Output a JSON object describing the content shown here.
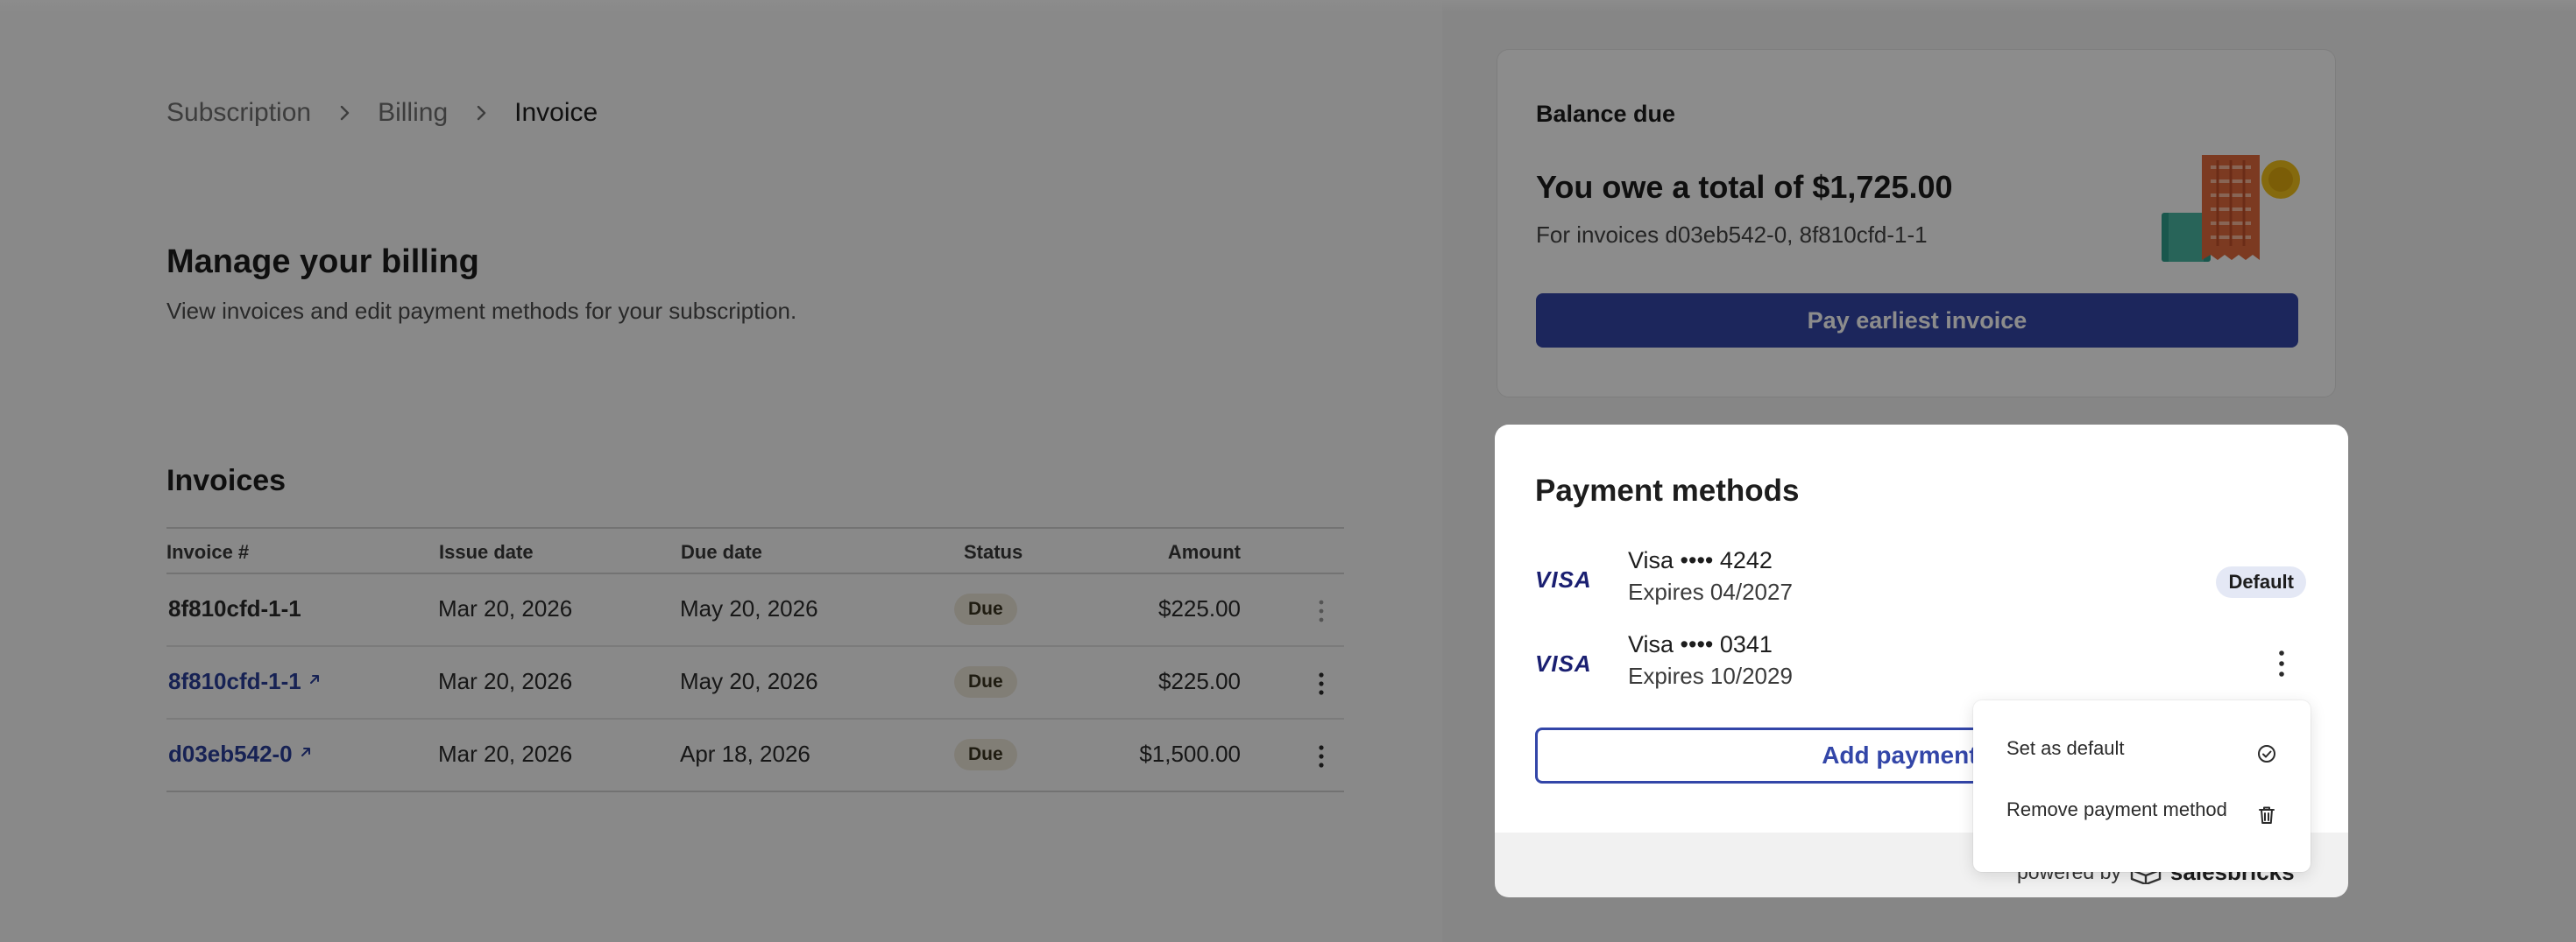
{
  "breadcrumb": {
    "items": [
      "Subscription",
      "Billing",
      "Invoice"
    ]
  },
  "page": {
    "title": "Manage your billing",
    "subtitle": "View invoices and edit payment methods for your subscription."
  },
  "invoices": {
    "title": "Invoices",
    "columns": [
      "Invoice #",
      "Issue date",
      "Due date",
      "Status",
      "Amount"
    ],
    "rows": [
      {
        "id": "8f810cfd-1-1",
        "link": false,
        "issue": "Mar 20, 2026",
        "due": "May 20, 2026",
        "status": "Due",
        "amount": "$225.00"
      },
      {
        "id": "8f810cfd-1-1",
        "link": true,
        "issue": "Mar 20, 2026",
        "due": "May 20, 2026",
        "status": "Due",
        "amount": "$225.00"
      },
      {
        "id": "d03eb542-0",
        "link": true,
        "issue": "Mar 20, 2026",
        "due": "Apr 18, 2026",
        "status": "Due",
        "amount": "$1,500.00"
      }
    ]
  },
  "balance": {
    "label": "Balance due",
    "total": "You owe a total of $1,725.00",
    "sub": "For invoices d03eb542-0, 8f810cfd-1-1",
    "pay_button": "Pay earliest invoice"
  },
  "payment_methods": {
    "title": "Payment methods",
    "cards": [
      {
        "brand": "VISA",
        "name": "Visa •••• 4242",
        "expires": "Expires 04/2027",
        "badge": "Default"
      },
      {
        "brand": "VISA",
        "name": "Visa •••• 0341",
        "expires": "Expires 10/2029",
        "badge": ""
      }
    ],
    "add_button": "Add payment me",
    "powered_by": "powered by",
    "brand": "salesbricks"
  },
  "menu": {
    "items": [
      {
        "label": "Set as default",
        "icon": "check-circle-icon"
      },
      {
        "label": "Remove payment method",
        "icon": "trash-icon"
      }
    ]
  },
  "colors": {
    "accent": "#3346a8",
    "link": "#2a3f9a",
    "badge_due": "#ebe5d8",
    "badge_default": "#e4e8f5",
    "visa": "#1a1f71"
  }
}
